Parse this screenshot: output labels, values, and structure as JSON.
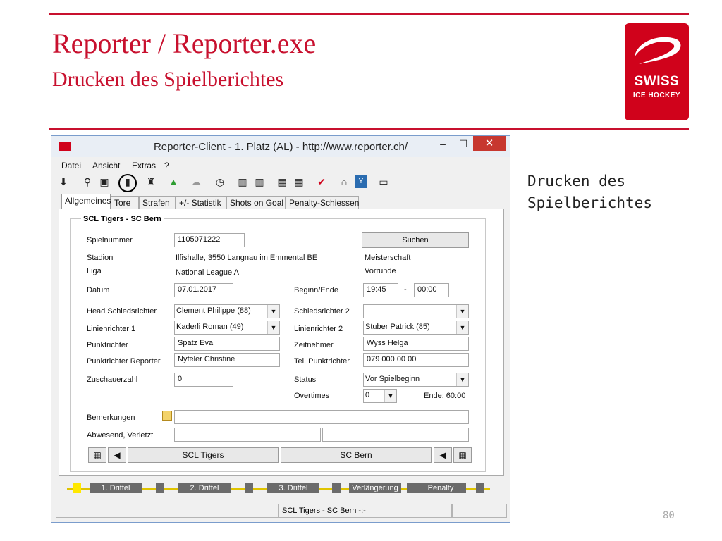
{
  "slide": {
    "title": "Reporter / Reporter.exe",
    "subtitle": "Drucken des Spielberichtes",
    "side_note": "Drucken des\nSpielberichtes",
    "page_number": "80",
    "logo": {
      "line1": "SWISS",
      "line2": "ICE HOCKEY"
    },
    "accent_color": "#c8102e"
  },
  "window": {
    "title": "Reporter-Client  -  1. Platz (AL)  -  http://www.reporter.ch/",
    "minimize": "–",
    "maximize": "☐",
    "close": "✕"
  },
  "menu": [
    "Datei",
    "Ansicht",
    "Extras",
    "?"
  ],
  "toolbar_icons": [
    "download-icon",
    "search-icon",
    "save-icon",
    "print-report-icon",
    "referee-icon",
    "upload-icon",
    "cloud-icon",
    "timer-icon",
    "lineup-icon",
    "lineup2-icon",
    "team-icon",
    "team2-icon",
    "check-icon",
    "home-icon",
    "youtube-icon",
    "tv-icon"
  ],
  "tabs": [
    "Allgemeines",
    "Tore",
    "Strafen",
    "+/- Statistik",
    "Shots on Goal",
    "Penalty-Schiessen"
  ],
  "group_title": "SCL Tigers - SC Bern",
  "form": {
    "spielnummer_label": "Spielnummer",
    "spielnummer": "1105071222",
    "suchen": "Suchen",
    "stadion_label": "Stadion",
    "stadion": "Ilfishalle, 3550 Langnau im Emmental BE",
    "meisterschaft": "Meisterschaft",
    "liga_label": "Liga",
    "liga": "National League A",
    "vorrunde": "Vorrunde",
    "datum_label": "Datum",
    "datum": "07.01.2017",
    "beginn_label": "Beginn/Ende",
    "beginn": "19:45",
    "dash": "-",
    "ende": "00:00",
    "head_sr_label": "Head Schiedsrichter",
    "head_sr": "Clement Philippe (88)",
    "sr2_label": "Schiedsrichter 2",
    "sr2": "",
    "lr1_label": "Linienrichter 1",
    "lr1": "Kaderli Roman (49)",
    "lr2_label": "Linienrichter 2",
    "lr2": "Stuber Patrick (85)",
    "punktrichter_label": "Punktrichter",
    "punktrichter": "Spatz Eva",
    "zeitnehmer_label": "Zeitnehmer",
    "zeitnehmer": "Wyss Helga",
    "pr_reporter_label": "Punktrichter Reporter",
    "pr_reporter": "Nyfeler Christine",
    "tel_label": "Tel. Punktrichter",
    "tel": "079 000 00 00",
    "zuschauer_label": "Zuschauerzahl",
    "zuschauer": "0",
    "status_label": "Status",
    "status": "Vor Spielbeginn",
    "overtimes_label": "Overtimes",
    "overtimes": "0",
    "ende_label": "Ende: 60:00",
    "bemerkungen_label": "Bemerkungen",
    "abwesend_label": "Abwesend, Verletzt",
    "home_team": "SCL Tigers",
    "away_team": "SC Bern"
  },
  "periods": [
    "1. Drittel",
    "2. Drittel",
    "3. Drittel",
    "Verlängerung",
    "Penalty"
  ],
  "statusbar": {
    "match": "SCL Tigers - SC Bern -:-"
  }
}
